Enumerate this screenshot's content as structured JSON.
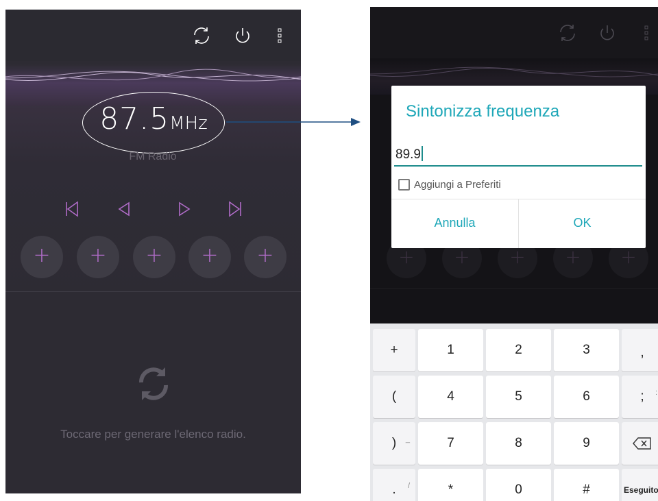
{
  "left_screen": {
    "frequency": "87.5",
    "unit": "MHz",
    "band_label": "FM Radio",
    "preset_symbol": "+",
    "preset_count": 5,
    "empty_list_message": "Toccare per generare l'elenco radio.",
    "icons": [
      "refresh-icon",
      "power-icon",
      "overflow-menu-icon",
      "skip-previous-icon",
      "seek-back-icon",
      "seek-forward-icon",
      "skip-next-icon",
      "refresh-large-icon"
    ],
    "accent_color": "#b06cc8"
  },
  "right_screen": {
    "dialog": {
      "title": "Sintonizza frequenza",
      "input_value": "89.9",
      "checkbox_label": "Aggiungi a Preferiti",
      "checkbox_checked": false,
      "cancel_label": "Annulla",
      "ok_label": "OK"
    },
    "keyboard": {
      "rows": [
        [
          "+",
          "1",
          "2",
          "3",
          ","
        ],
        [
          "(",
          "4",
          "5",
          "6",
          ";"
        ],
        [
          ")",
          "7",
          "8",
          "9",
          ""
        ],
        [
          ".",
          "*",
          "0",
          "#",
          "Eseguito"
        ]
      ],
      "subs": [
        [
          "",
          "",
          "",
          "",
          ""
        ],
        [
          "",
          "",
          "",
          "",
          ":"
        ],
        [
          "_",
          "",
          "",
          "",
          ""
        ],
        [
          "/",
          "",
          "",
          "",
          ""
        ]
      ],
      "backspace_icon": "backspace-icon"
    },
    "accent_color": "#1ea7b8"
  }
}
